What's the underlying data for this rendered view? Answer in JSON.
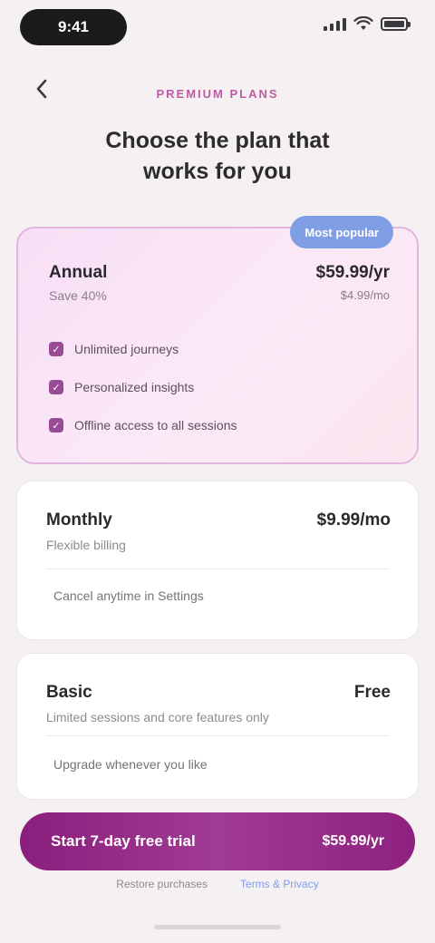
{
  "status_bar": {
    "time": "9:41",
    "icons": [
      "signal-icon",
      "wifi-icon",
      "battery-icon"
    ]
  },
  "header": {
    "back_icon": "chevron-left-icon",
    "eyebrow": "PREMIUM PLANS",
    "title": "Choose the plan that works for you"
  },
  "plans": {
    "annual": {
      "badge": "Most popular",
      "name": "Annual",
      "subtitle": "Save 40%",
      "price": "$59.99/yr",
      "price_note": "$4.99/mo",
      "features": [
        "Unlimited journeys",
        "Personalized insights",
        "Offline access to all sessions"
      ]
    },
    "monthly": {
      "name": "Monthly",
      "subtitle": "Flexible billing",
      "price": "$9.99/mo",
      "detail": "Cancel anytime in Settings"
    },
    "free": {
      "name": "Basic",
      "price": "Free",
      "subtitle": "Limited sessions and core features only",
      "detail": "Upgrade whenever you like"
    }
  },
  "cta": {
    "label": "Start 7-day free trial",
    "price": "$59.99/yr"
  },
  "footer": {
    "restore": "Restore purchases",
    "terms": "Terms & Privacy"
  },
  "colors": {
    "accent": "#8a1e7d",
    "eyebrow": "#c05aa6",
    "badge": "#7f9ee6",
    "background": "#f5f1f2"
  }
}
